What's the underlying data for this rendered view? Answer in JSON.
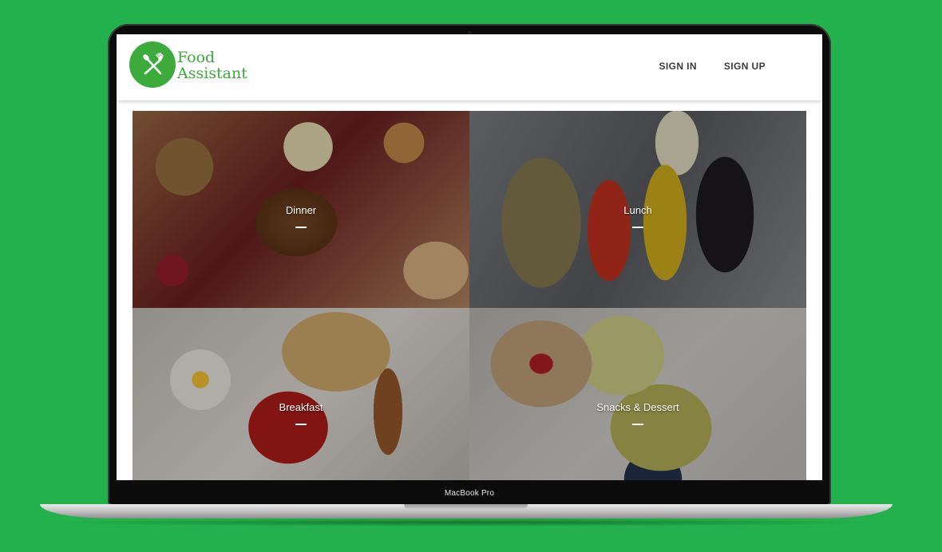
{
  "device": {
    "label": "MacBook Pro"
  },
  "header": {
    "brand_line1": "Food",
    "brand_line2": "Assistant",
    "logo_icon": "fork-knife-icon",
    "nav": {
      "sign_in": "SIGN IN",
      "sign_up": "SIGN UP"
    }
  },
  "categories": [
    {
      "label": "Dinner"
    },
    {
      "label": "Lunch"
    },
    {
      "label": "Breakfast"
    },
    {
      "label": "Snacks & Dessert"
    }
  ],
  "colors": {
    "background": "#22b14c",
    "brand_green": "#3cab3b"
  }
}
